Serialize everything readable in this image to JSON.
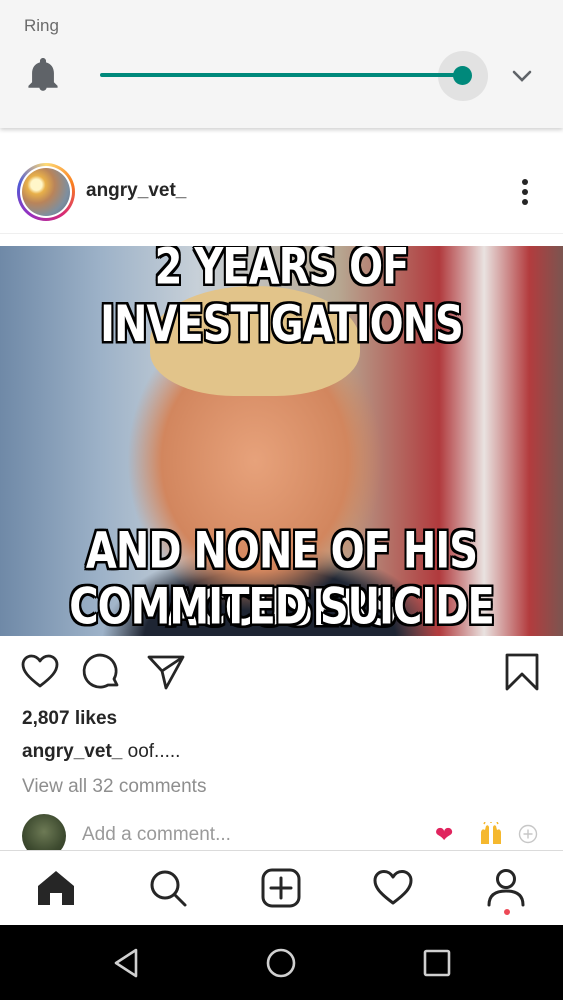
{
  "volume_panel": {
    "label": "Ring",
    "level": 1.0,
    "accent_color": "#00897b",
    "icons": {
      "ringer": "bell-icon",
      "expand": "chevron-down-icon"
    }
  },
  "post": {
    "username": "angry_vet_",
    "image_text": {
      "top": "2 YEARS OF INVESTIGATIONS",
      "bottom_line1": "AND NONE OF HIS ACCUSERS",
      "bottom_line2": "COMMITED SUICIDE"
    },
    "likes": "2,807 likes",
    "caption_user": "angry_vet_",
    "caption_text": " oof.....",
    "view_comments": "View all 32 comments",
    "add_comment_placeholder": "Add a comment...",
    "quick_emojis": [
      "heart-emoji",
      "raising-hands-emoji",
      "add-emoji-icon"
    ],
    "actions": [
      "like-heart-icon",
      "comment-icon",
      "share-send-icon",
      "save-bookmark-icon"
    ]
  },
  "tab_bar": {
    "tabs": [
      "home-icon",
      "search-icon",
      "create-post-icon",
      "activity-heart-icon",
      "profile-icon"
    ],
    "notification_dot_color": "#ed4956"
  },
  "system_nav": {
    "buttons": [
      "back-icon",
      "home-circle-icon",
      "recents-icon"
    ]
  }
}
